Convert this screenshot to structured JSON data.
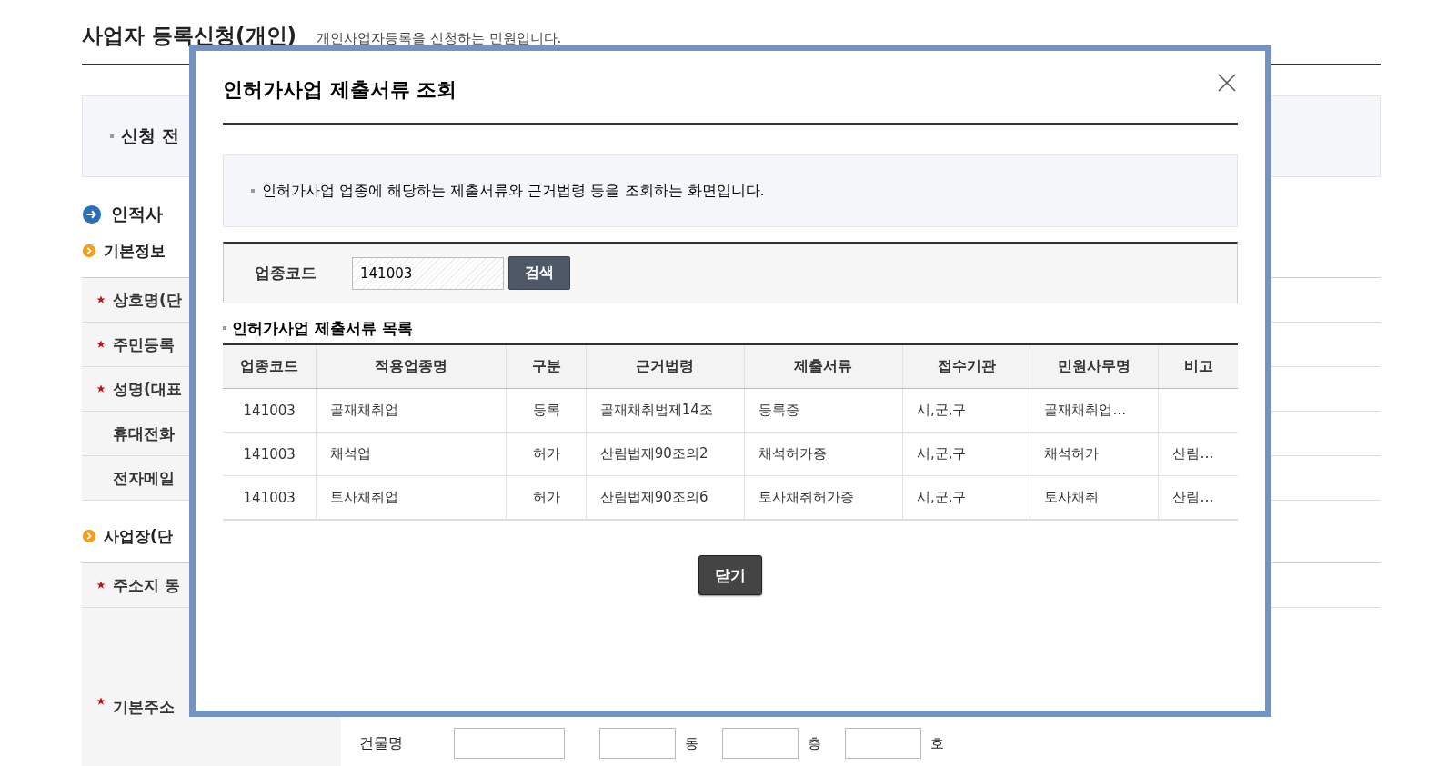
{
  "page": {
    "title": "사업자 등록신청(개인)",
    "subtitle": "개인사업자등록을 신청하는 민원입니다.",
    "notice": "신청 전",
    "personal_section": "인적사",
    "basic_info": "기본정보",
    "basic_fields": [
      {
        "label": "상호명(단",
        "required": true
      },
      {
        "label": "주민등록",
        "required": true
      },
      {
        "label": "성명(대표",
        "required": true
      },
      {
        "label": "휴대전화",
        "required": false
      },
      {
        "label": "전자메일",
        "required": false
      }
    ],
    "business_section": "사업장(단",
    "business_fields": [
      {
        "label": "주소지 동",
        "required": true
      },
      {
        "label": "기본주소",
        "required": true
      }
    ],
    "building": {
      "label": "건물명",
      "units": [
        "동",
        "층",
        "호"
      ]
    }
  },
  "modal": {
    "title": "인허가사업 제출서류 조회",
    "description": "인허가사업 업종에 해당하는 제출서류와 근거법령 등을 조회하는 화면입니다.",
    "search": {
      "label": "업종코드",
      "value": "141003",
      "button": "검색"
    },
    "list_title": "인허가사업 제출서류 목록",
    "table": {
      "columns": [
        "업종코드",
        "적용업종명",
        "구분",
        "근거법령",
        "제출서류",
        "접수기관",
        "민원사무명",
        "비고"
      ],
      "rows": [
        [
          "141003",
          "골재채취업",
          "등록",
          "골재채취법제14조",
          "등록증",
          "시,군,구",
          "골재채취업…",
          ""
        ],
        [
          "141003",
          "채석업",
          "허가",
          "산림법제90조의2",
          "채석허가증",
          "시,군,구",
          "채석허가",
          "산림…"
        ],
        [
          "141003",
          "토사채취업",
          "허가",
          "산림법제90조의6",
          "토사채취허가증",
          "시,군,구",
          "토사채취",
          "산림…"
        ]
      ]
    },
    "close_button": "닫기"
  }
}
